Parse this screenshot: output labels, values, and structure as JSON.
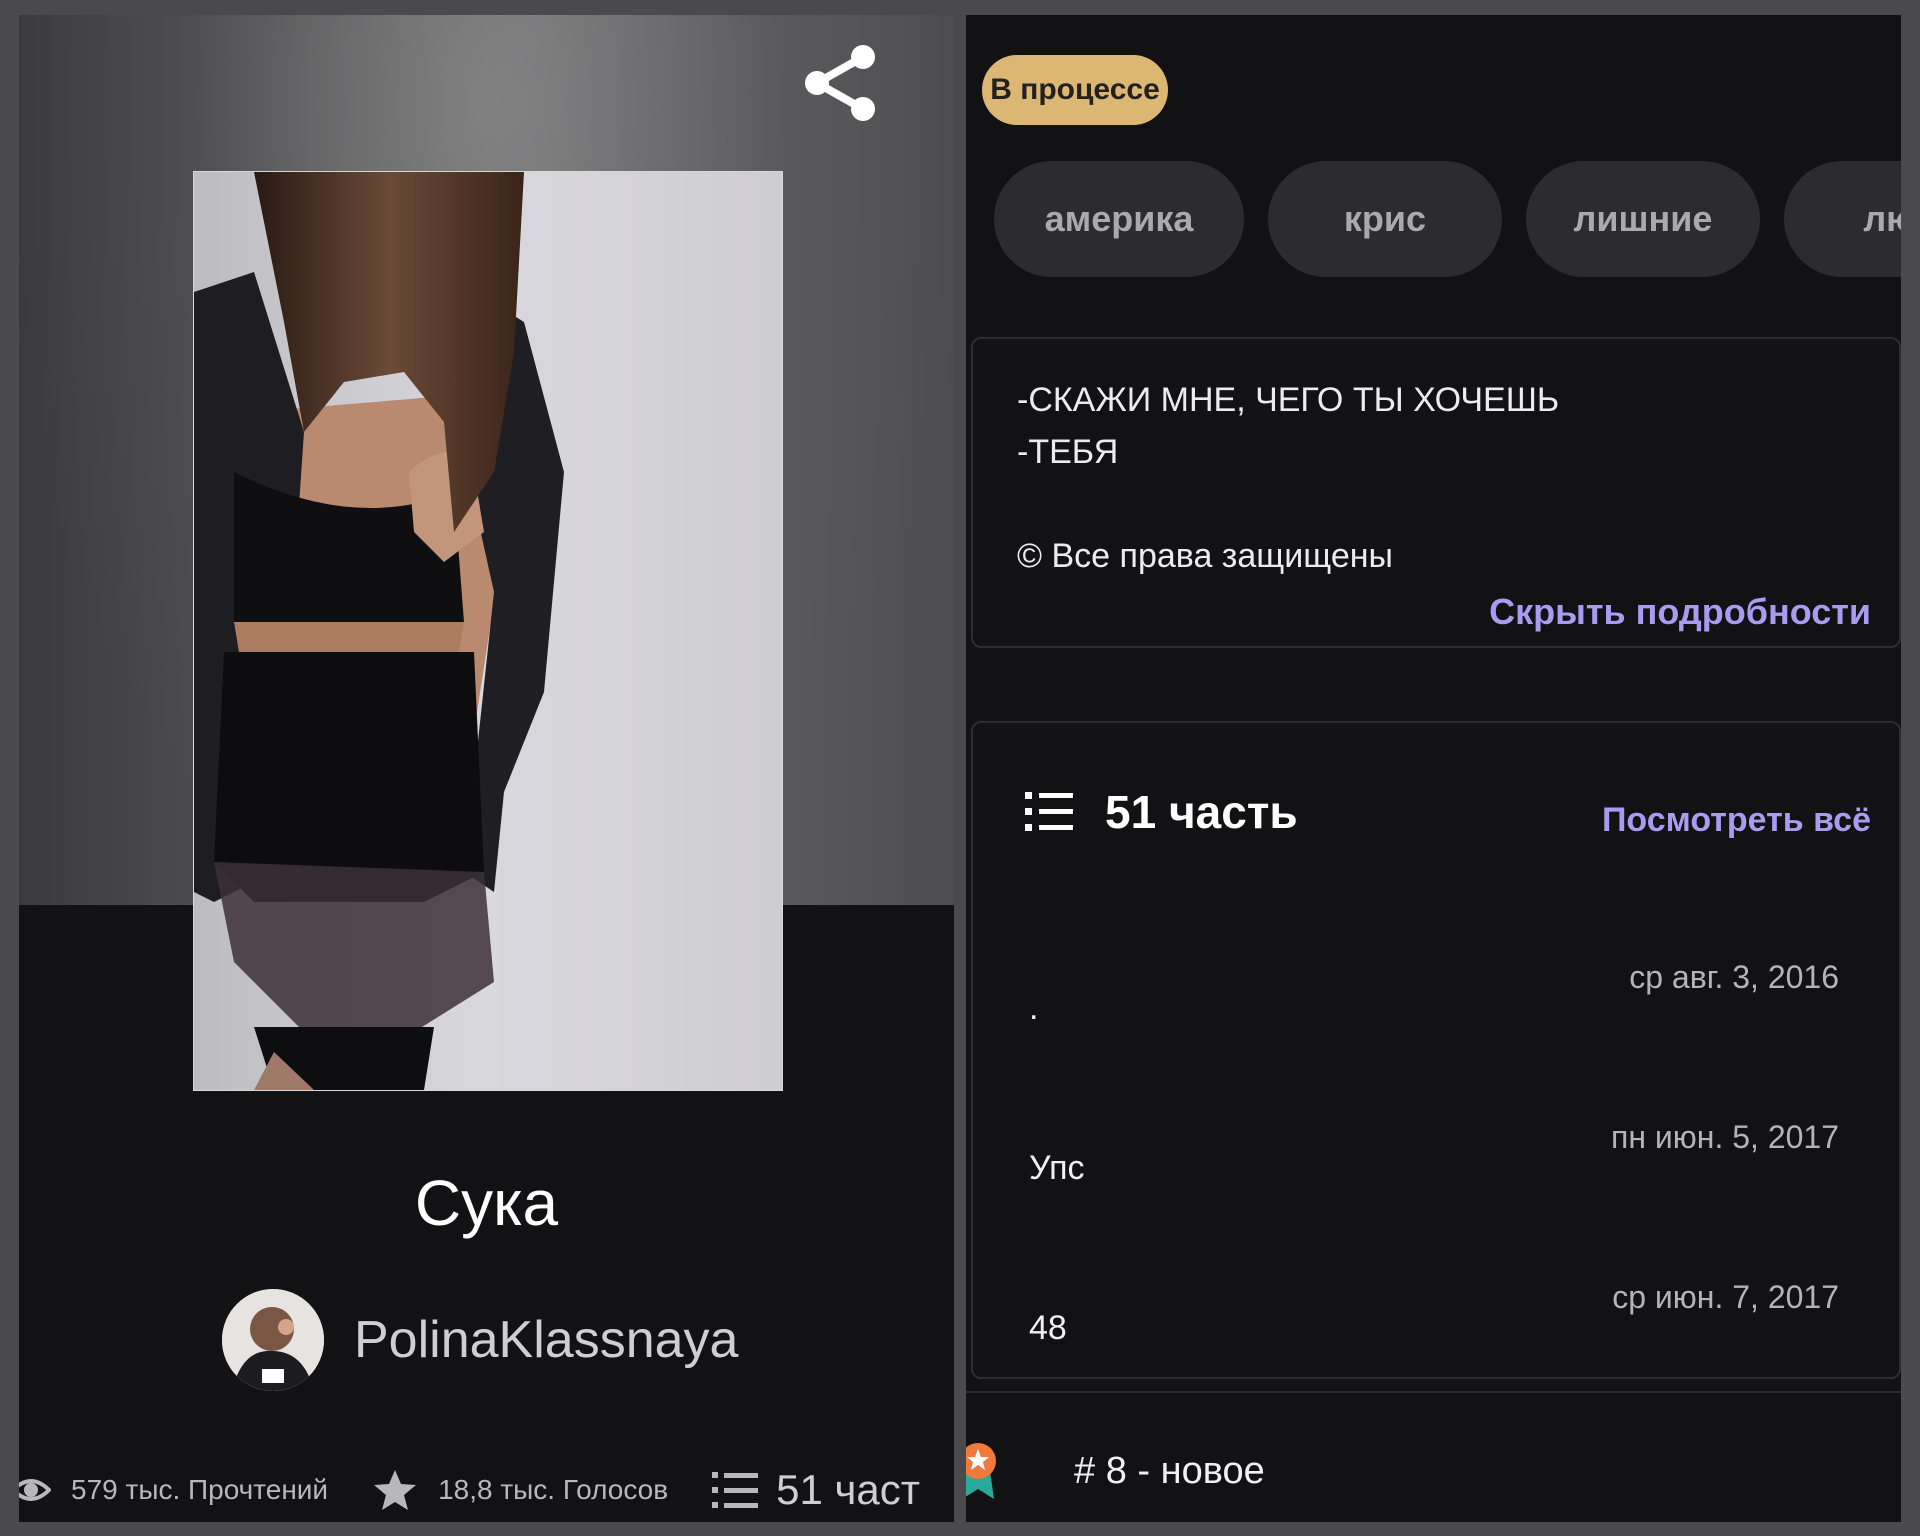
{
  "story": {
    "title": "Сука",
    "author": "PolinaKlassnaya"
  },
  "stats": {
    "reads": "579 тыс. Прочтений",
    "votes": "18,8 тыс. Голосов",
    "parts": "51 част"
  },
  "status": "В процессе",
  "tags": [
    "америка",
    "крис",
    "лишние",
    "люб"
  ],
  "description": {
    "lines": [
      "-СКАЖИ МНЕ, ЧЕГО ТЫ ХОЧЕШЬ",
      "-ТЕБЯ",
      "© Все права защищены"
    ],
    "hide_label": "Скрыть подробности"
  },
  "toc": {
    "count_label": "51 часть",
    "view_all_label": "Посмотреть всё",
    "parts": [
      {
        "title": ".",
        "date": "ср авг. 3, 2016"
      },
      {
        "title": "Упс",
        "date": "пн июн. 5, 2017"
      },
      {
        "title": "48",
        "date": "ср июн. 7, 2017"
      }
    ]
  },
  "ranking": "# 8 - новое",
  "colors": {
    "accent_link": "#a99bf0",
    "status_badge": "#dcb774",
    "background": "#121114",
    "tag_bg": "#2c2c2f"
  },
  "icons": [
    "share-icon",
    "eye-icon",
    "star-icon",
    "list-icon",
    "award-icon"
  ]
}
